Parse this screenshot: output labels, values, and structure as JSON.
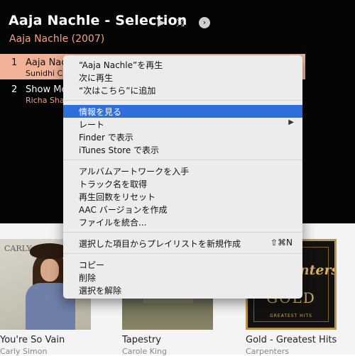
{
  "header": {
    "album_title": "Aaja Nachle - Selection",
    "album_subtitle": "Aaja Nachle (2007)",
    "play_icon": "play-icon",
    "shuffle_icon": "shuffle-icon",
    "more_icon": "more-icon",
    "play_glyph": "▶",
    "shuffle_glyph": "⤨",
    "more_glyph": "›"
  },
  "tracks": [
    {
      "number": "1",
      "name": "Aaja Nachle",
      "artist": "Sunidhi Chauhan"
    },
    {
      "number": "2",
      "name": "Show Me Your Jalwa",
      "artist": "Richa Sharma"
    }
  ],
  "context_menu": {
    "items": [
      {
        "label": "“Aaja Nachle”を再生"
      },
      {
        "label": "次に再生"
      },
      {
        "label": "“次はこちら”に追加"
      },
      {
        "label": "情報を見る"
      },
      {
        "label": "レート",
        "submenu_glyph": "▶"
      },
      {
        "label": "Finder で表示"
      },
      {
        "label": "iTunes Store で表示"
      },
      {
        "label": "アルバムアートワークを入手"
      },
      {
        "label": "トラック名を取得"
      },
      {
        "label": "再生回数をリセット"
      },
      {
        "label": "AAC バージョンを作成"
      },
      {
        "label": "ファイルを統合..."
      },
      {
        "label": "選択した項目からプレイリストを新規作成",
        "shortcut": "⇧⌘N"
      },
      {
        "label": "コピー"
      },
      {
        "label": "削除"
      },
      {
        "label": "選択を解除"
      }
    ],
    "highlighted_item": "情報を見る",
    "highlight_color": "#2f6fdc"
  },
  "albums": [
    {
      "title": "You're So Vain",
      "artist": "Carly Simon",
      "cover_text": "CARLY SIMON"
    },
    {
      "title": "Tapestry",
      "artist": "Carole King"
    },
    {
      "title": "Gold - Greatest Hits",
      "artist": "Carpenters",
      "cover_text": [
        "Carpenters",
        "GOLD",
        "GREATEST HITS"
      ]
    }
  ],
  "colors": {
    "accent": "#f0a488",
    "selected_row": "#f0b39a",
    "background_dark": "#050505"
  }
}
